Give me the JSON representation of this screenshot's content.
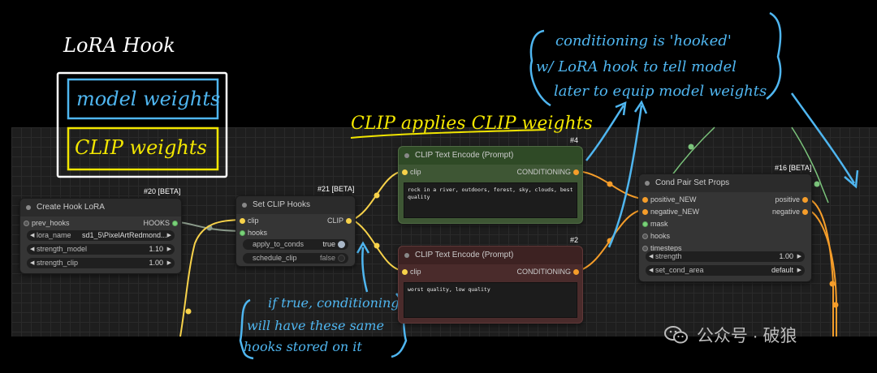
{
  "annotations": {
    "lora_hook_title": "LoRA Hook",
    "model_weights": "model weights",
    "clip_weights": "CLIP weights",
    "clip_applies": "CLIP applies CLIP weights",
    "conditioning_note_1": "conditioning is 'hooked'",
    "conditioning_note_2": "w/ LoRA hook to tell model",
    "conditioning_note_3": "later to equip model weights",
    "iftrue_1": "if true, conditioning",
    "iftrue_2": "will have these same",
    "iftrue_3": "hooks stored on it"
  },
  "nodes": {
    "create_hook_lora": {
      "badge": "#20 [BETA]",
      "title": "Create Hook LoRA",
      "input_prev_hooks": "prev_hooks",
      "output_hooks": "HOOKS",
      "lora_name_label": "lora_name",
      "lora_name_value": "sd1_5\\PixelArtRedmond...",
      "strength_model_label": "strength_model",
      "strength_model_value": "1.10",
      "strength_clip_label": "strength_clip",
      "strength_clip_value": "1.00"
    },
    "set_clip_hooks": {
      "badge": "#21 [BETA]",
      "title": "Set CLIP Hooks",
      "input_clip": "clip",
      "input_hooks": "hooks",
      "output_clip": "CLIP",
      "apply_to_conds_label": "apply_to_conds",
      "apply_to_conds_value": "true",
      "schedule_clip_label": "schedule_clip",
      "schedule_clip_value": "false"
    },
    "clip_text_encode_pos": {
      "badge": "#4",
      "title": "CLIP Text Encode (Prompt)",
      "input_clip": "clip",
      "output": "CONDITIONING",
      "text": "rock in a river, outdoors, forest, sky, clouds, best quality"
    },
    "clip_text_encode_neg": {
      "badge": "#2",
      "title": "CLIP Text Encode (Prompt)",
      "input_clip": "clip",
      "output": "CONDITIONING",
      "text": "worst quality, low quality"
    },
    "cond_pair_set_props": {
      "badge": "#16 [BETA]",
      "title": "Cond Pair Set Props",
      "input_positive": "positive_NEW",
      "input_negative": "negative_NEW",
      "input_mask": "mask",
      "input_hooks": "hooks",
      "input_timesteps": "timesteps",
      "output_positive": "positive",
      "output_negative": "negative",
      "strength_label": "strength",
      "strength_value": "1.00",
      "set_cond_area_label": "set_cond_area",
      "set_cond_area_value": "default"
    }
  },
  "watermark": "公众号 · 破狼",
  "colors": {
    "clip_wire": "#f7d24a",
    "conditioning_wire": "#f59d2a",
    "hooks_wire": "#8fbc8f",
    "annotation_blue": "#4fb6f0",
    "annotation_yellow": "#f2e600",
    "annotation_white": "#ffffff"
  }
}
